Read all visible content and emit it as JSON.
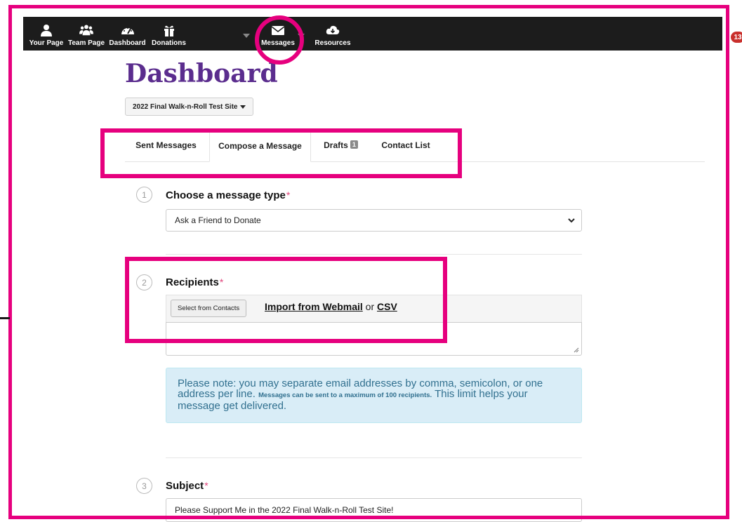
{
  "nav": {
    "items": [
      {
        "label": "Your Page",
        "icon": "user-icon"
      },
      {
        "label": "Team Page",
        "icon": "team-icon"
      },
      {
        "label": "Dashboard",
        "icon": "dashboard-gauge-icon"
      },
      {
        "label": "Donations",
        "icon": "gift-icon"
      },
      {
        "label": "Messages",
        "icon": "envelope-icon"
      },
      {
        "label": "Resources",
        "icon": "cloud-download-icon"
      }
    ],
    "notification_count": "13"
  },
  "page": {
    "title": "Dashboard",
    "site_select": "2022 Final Walk-n-Roll Test Site"
  },
  "tabs": [
    {
      "label": "Sent Messages"
    },
    {
      "label": "Compose a Message",
      "active": true
    },
    {
      "label": "Drafts",
      "count": "1"
    },
    {
      "label": "Contact List"
    }
  ],
  "steps": {
    "type": {
      "number": "1",
      "title": "Choose a message type",
      "selected": "Ask a Friend to Donate"
    },
    "recipients": {
      "number": "2",
      "title": "Recipients",
      "select_button": "Select from Contacts",
      "import_webmail": "Import from Webmail",
      "or_text": "or",
      "csv": "CSV",
      "value": ""
    },
    "note": {
      "text1": "Please note: you may separate email addresses by comma, semicolon, or one address per line.",
      "small": "Messages can be sent to a maximum of 100 recipients.",
      "text2": "This limit helps your message get delivered."
    },
    "subject": {
      "number": "3",
      "title": "Subject",
      "value": "Please Support Me in the 2022 Final Walk-n-Roll Test Site!"
    }
  },
  "required_marker": "*",
  "colors": {
    "highlight": "#e6007e",
    "title_purple": "#5b2d8e",
    "nav_bg": "#1c1c1c",
    "note_bg": "#d9edf7",
    "badge": "#c9302c"
  }
}
